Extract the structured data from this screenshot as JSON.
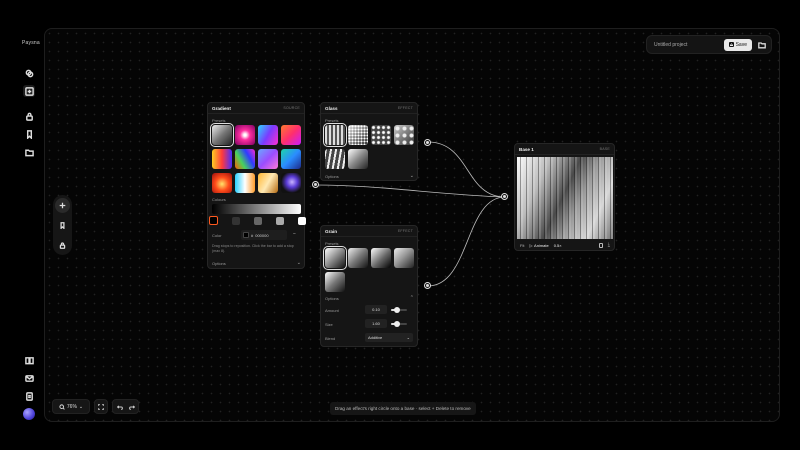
{
  "app": {
    "brand": "Paysna"
  },
  "project": {
    "name": "Untitled project",
    "save_label": "Save"
  },
  "gradient_panel": {
    "title": "Gradient",
    "tag": "SOURCE",
    "presets_label": "Presets",
    "colours_label": "Colours",
    "color_label": "Color",
    "hex_prefix": "#",
    "hex_value": "000000",
    "remove_label": "−",
    "help": "Drag stops to reposition. Click the bar to add a stop (max 8).",
    "options_label": "Options"
  },
  "glass_panel": {
    "title": "Glass",
    "tag": "EFFECT",
    "presets_label": "Presets",
    "options_label": "Options"
  },
  "grain_panel": {
    "title": "Grain",
    "tag": "EFFECT",
    "presets_label": "Presets",
    "options_label": "Options",
    "amount_label": "Amount",
    "amount_value": "0.10",
    "amount_level": 0.1,
    "size_label": "Size",
    "size_value": "1.60",
    "size_level": 0.4,
    "blend_label": "Blend",
    "blend_value": "Additive"
  },
  "base_panel": {
    "title": "Base 1",
    "tag": "BASE",
    "fit_label": "Fit",
    "animate_label": "Animate",
    "speed_value": "0.5×"
  },
  "canvas": {
    "zoom": "76%",
    "hint": "Drag an effect's right circle onto a base · select + Delete to remove"
  },
  "icons": {
    "rail": [
      "layers-icon",
      "add-node-icon",
      "lock-icon",
      "bookmark-icon",
      "folder-icon"
    ],
    "rail_bottom": [
      "book-icon",
      "mail-icon",
      "document-icon"
    ]
  }
}
